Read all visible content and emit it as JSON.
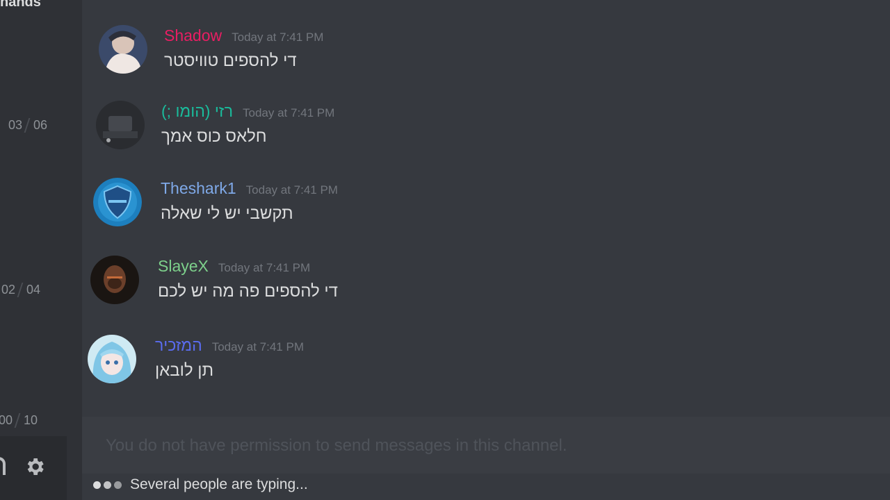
{
  "sidebar": {
    "label": "hands",
    "voice_counts": [
      {
        "a": "03",
        "b": "06"
      },
      {
        "a": "02",
        "b": "04"
      },
      {
        "a": "00",
        "b": "10"
      }
    ],
    "icons": [
      "headset-icon",
      "gear-icon"
    ]
  },
  "messages": [
    {
      "username": "Shadow",
      "color": "#e91e63",
      "timestamp": "Today at 7:41 PM",
      "text": "די להספים טוויסטר",
      "avatar": "avatar-shadow"
    },
    {
      "username": "(; רזי (הומו",
      "color": "#1abc9c",
      "timestamp": "Today at 7:41 PM",
      "text": "חלאס כוס אמך",
      "avatar": "avatar-razi"
    },
    {
      "username": "Theshark1",
      "color": "#7fa9e8",
      "timestamp": "Today at 7:41 PM",
      "text": "תקשבי יש לי שאלה",
      "avatar": "avatar-theshark1"
    },
    {
      "username": "SlayeX",
      "color": "#7dd08b",
      "timestamp": "Today at 7:41 PM",
      "text": "די להספים פה מה יש לכם",
      "avatar": "avatar-slayex"
    },
    {
      "username": "המזכיר",
      "color": "#5a6cf0",
      "timestamp": "Today at 7:41 PM",
      "text": "תן לובאן",
      "avatar": "avatar-hamazkir"
    }
  ],
  "composer": {
    "placeholder": "You do not have permission to send messages in this channel."
  },
  "typing": {
    "text": "Several people are typing..."
  }
}
